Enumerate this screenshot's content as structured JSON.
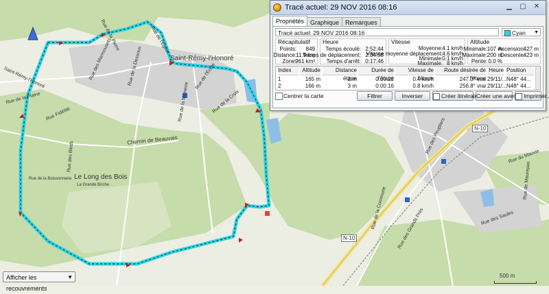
{
  "window": {
    "title": "Tracé actuel: 29 NOV 2016 08:16"
  },
  "tabs": [
    "Propriétés",
    "Graphique",
    "Remarques"
  ],
  "track": {
    "name": "Tracé actuel: 29 NOV 2016 08:16",
    "color_name": "Cyan",
    "color_hex": "#2fd3e3"
  },
  "summary": {
    "title": "Récapitulatif",
    "rows": [
      {
        "label": "Points:",
        "value": "849"
      },
      {
        "label": "Distance:",
        "value": "11.9 km"
      },
      {
        "label": "Zone:",
        "value": "961 km²"
      }
    ]
  },
  "time": {
    "title": "Heure",
    "rows": [
      {
        "label": "Temps écoulé:",
        "value": "2:52:44"
      },
      {
        "label": "Temps de déplacement:",
        "value": "2:34:58"
      },
      {
        "label": "Temps d'arrêt:",
        "value": "0:17:46"
      }
    ]
  },
  "speed": {
    "title": "Vitesse",
    "rows": [
      {
        "label": "Moyenne:",
        "value": "4.1 km/h"
      },
      {
        "label": "Vitesse moyenne déplacement:",
        "value": "4.6 km/h"
      },
      {
        "label": "Minimale:",
        "value": "0.1 km/h"
      },
      {
        "label": "Maximale:",
        "value": "8 km/h"
      }
    ]
  },
  "altitude": {
    "title": "Altitude",
    "rows": [
      {
        "label": "Minimale:",
        "value": "107 m"
      },
      {
        "label": "Maximale:",
        "value": "200 m"
      },
      {
        "label": "Pente:",
        "value": "0.0 %"
      }
    ],
    "rows2": [
      {
        "label": "Ascension:",
        "value": "427 m"
      },
      {
        "label": "Descente:",
        "value": "423 m"
      }
    ]
  },
  "table": {
    "headers": [
      "Index",
      "Altitude",
      "Distance étape",
      "Durée de l'étape",
      "Vitesse de l'étape",
      "Route désirée de l'étape",
      "Heure",
      "Position"
    ],
    "rows": [
      [
        "1",
        "165 m",
        "2 m",
        "0:00:22",
        "0.4 km/h",
        "247.3° vrai",
        "29/11/...",
        "N48° 44..."
      ],
      [
        "2",
        "166 m",
        "3 m",
        "0:00:16",
        "0.8 km/h",
        "256.8° vrai",
        "29/11/...",
        "N48° 44..."
      ]
    ]
  },
  "controls": {
    "center_map": "Centrer la carte",
    "filter": "Filtrer",
    "invert": "Inverser",
    "create_route": "Créer itinéraire...",
    "create_adventure": "Créer une aventure...",
    "print": "Imprimer..."
  },
  "map": {
    "labels": {
      "town": "Saint-Rémy-l'Honoré",
      "long_des_bois": "Le Long des Bois",
      "chemin_beauvais": "Chemin de Beauvais",
      "rue_pierre": "Rue de la Pierre",
      "rue_eglise": "Rue de l'Église",
      "rue_marmousets": "Rue des Marmousets",
      "rue_dessous": "Rue de la Dessous",
      "rue_fidelite": "Rue Fidélité",
      "rue_bleds": "Rue des Bleds",
      "rue_buisson": "Rue de la Buissonnaria",
      "grande_briche": "La Grande Briche",
      "rue_plaine": "Rue de la Plaine",
      "saint_remy_road": "Saint-Rémy-l'Honoré",
      "rue_moinerie": "Rue de la Moinerie",
      "rue_ecole": "Rue de l'École",
      "rue_croix": "Rue de la Croix",
      "n10_a": "N-10",
      "n10_b": "N-10",
      "rue_commune": "Rue de la Commune",
      "rue_peupliers": "Rue des Peupliers",
      "rue_grands_pres": "Rue des Grands Prés",
      "rue_maurepas": "Rue de Maurepas",
      "rue_saules": "Rue des Saules",
      "rue_mauvie": "Rue du Mauvie"
    },
    "overlay_select": "Afficher les recouvrements",
    "scale": "500 m"
  },
  "colors": {
    "track": "#2fd3e3",
    "track_dark": "#0a5a66",
    "forest": "#c2dba6",
    "water": "#7fb6e6",
    "built": "#d2d2d2"
  }
}
